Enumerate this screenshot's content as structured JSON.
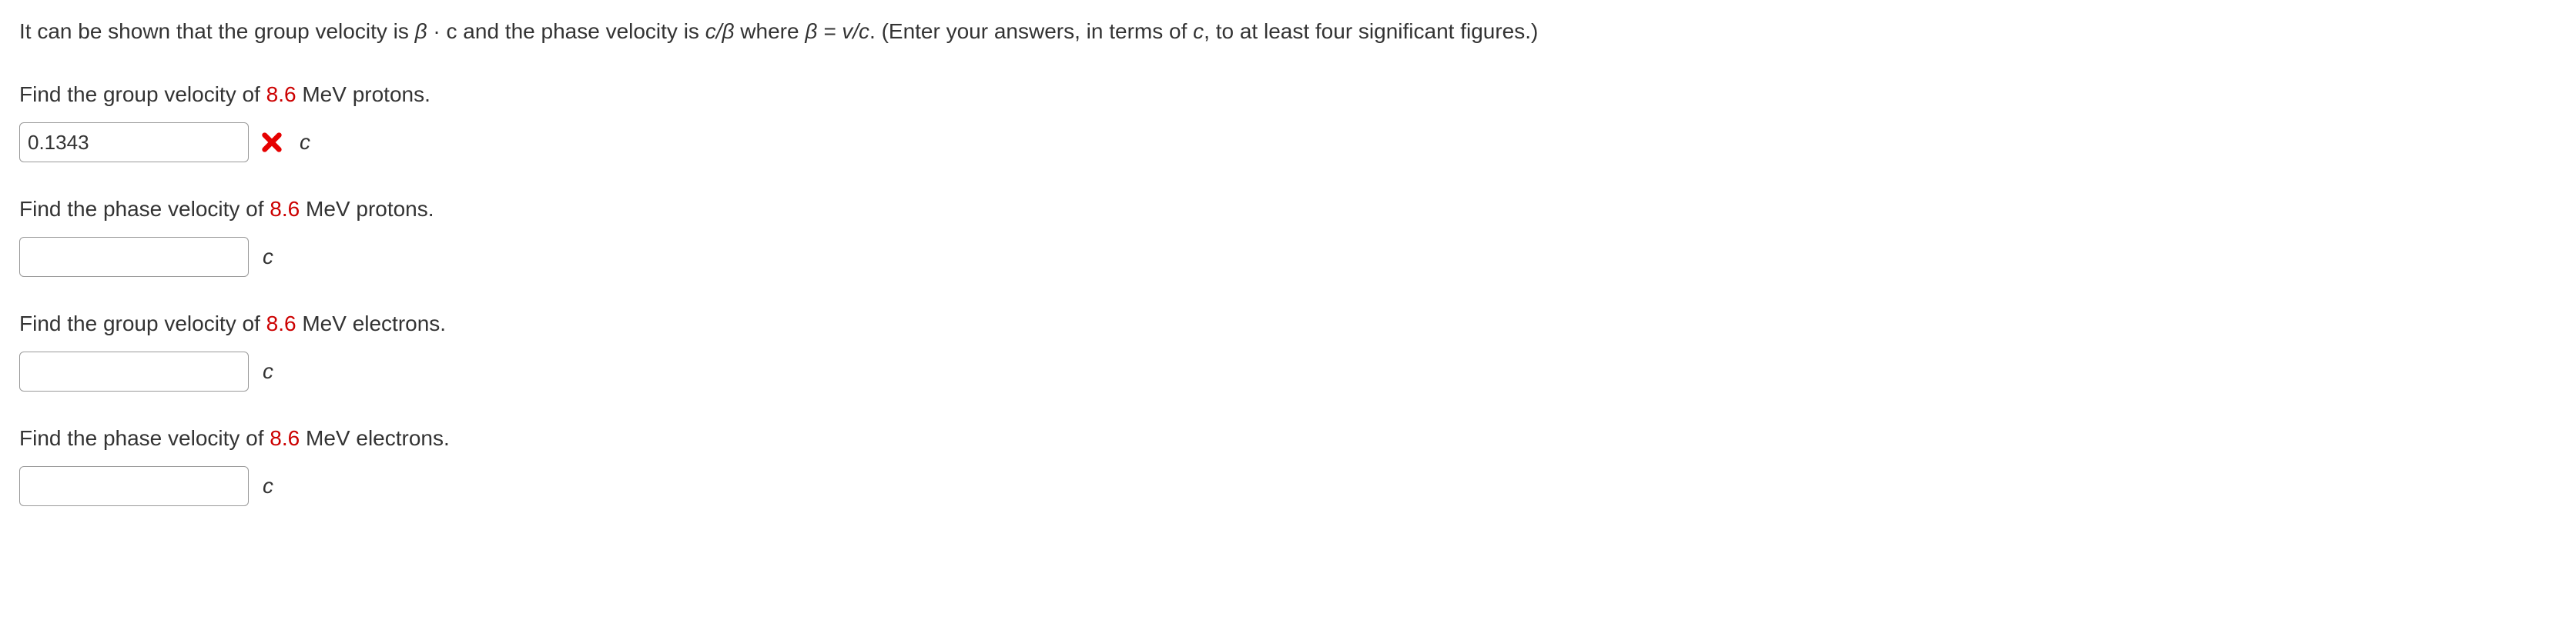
{
  "intro": {
    "part1": "It can be shown that the group velocity is ",
    "beta": "β",
    "dot_c": " · c",
    "part2": " and the phase velocity is ",
    "c_over_beta": "c/β",
    "where": " where ",
    "beta_eq": "β = v/c",
    "part3": ". (Enter your answers, in terms of ",
    "c_var": "c",
    "part4": ", to at least four significant figures.)"
  },
  "questions": [
    {
      "prompt_pre": "Find the group velocity of ",
      "energy": "8.6",
      "prompt_post": " MeV protons.",
      "value": "0.1343",
      "unit": "c",
      "incorrect": true
    },
    {
      "prompt_pre": "Find the phase velocity of ",
      "energy": "8.6",
      "prompt_post": " MeV protons.",
      "value": "",
      "unit": "c",
      "incorrect": false
    },
    {
      "prompt_pre": "Find the group velocity of ",
      "energy": "8.6",
      "prompt_post": " MeV electrons.",
      "value": "",
      "unit": "c",
      "incorrect": false
    },
    {
      "prompt_pre": "Find the phase velocity of ",
      "energy": "8.6",
      "prompt_post": " MeV electrons.",
      "value": "",
      "unit": "c",
      "incorrect": false
    }
  ]
}
